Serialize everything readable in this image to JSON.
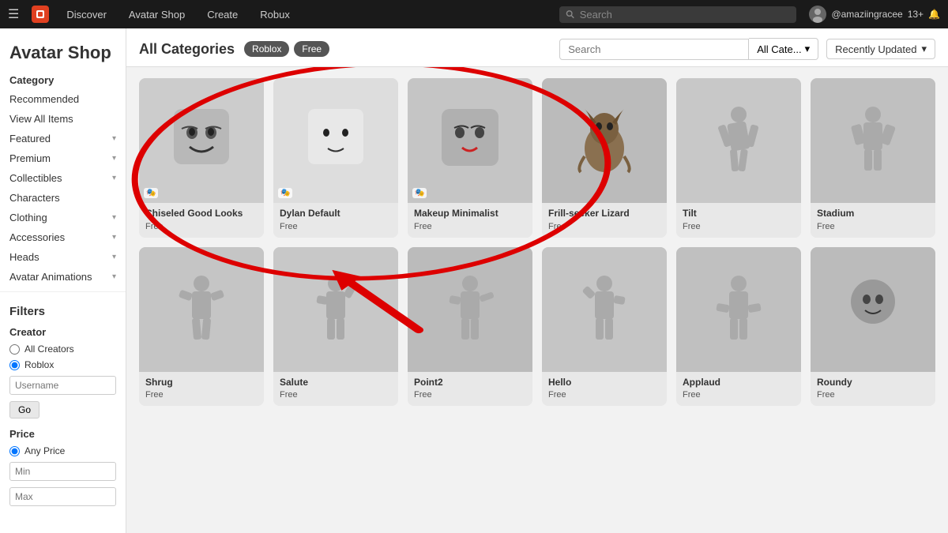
{
  "topbar": {
    "logo_text": "R",
    "links": [
      "Discover",
      "Avatar Shop",
      "Create",
      "Robux"
    ],
    "search_placeholder": "Search",
    "username": "@amaziingracee",
    "age": "13+"
  },
  "sidebar": {
    "page_title": "Avatar Shop",
    "section_label": "Category",
    "items": [
      {
        "label": "Recommended",
        "has_chevron": false
      },
      {
        "label": "View All Items",
        "has_chevron": false
      },
      {
        "label": "Featured",
        "has_chevron": true
      },
      {
        "label": "Premium",
        "has_chevron": true
      },
      {
        "label": "Collectibles",
        "has_chevron": true
      },
      {
        "label": "Characters",
        "has_chevron": false
      },
      {
        "label": "Clothing",
        "has_chevron": true
      },
      {
        "label": "Accessories",
        "has_chevron": true
      },
      {
        "label": "Heads",
        "has_chevron": true
      },
      {
        "label": "Avatar Animations",
        "has_chevron": true
      }
    ],
    "filters_title": "Filters",
    "creator_label": "Creator",
    "all_creators_label": "All Creators",
    "roblox_label": "Roblox",
    "username_placeholder": "Username",
    "go_button": "Go",
    "price_label": "Price",
    "any_price_label": "Any Price",
    "min_placeholder": "Min",
    "max_placeholder": "Max"
  },
  "content": {
    "title": "All Categories",
    "filters": [
      "Roblox",
      "Free"
    ],
    "sort_label": "Recently Updated",
    "search_placeholder": "Search",
    "allcate_label": "All Cate...",
    "items": [
      {
        "name": "Chiseled Good Looks",
        "price": "Free",
        "has_icon": true,
        "type": "face"
      },
      {
        "name": "Dylan Default",
        "price": "Free",
        "has_icon": true,
        "type": "face_simple"
      },
      {
        "name": "Makeup Minimalist",
        "price": "Free",
        "has_icon": true,
        "type": "face_makeup"
      },
      {
        "name": "Frill-seeker Lizard",
        "price": "Free",
        "has_icon": false,
        "type": "lizard"
      },
      {
        "name": "Tilt",
        "price": "Free",
        "has_icon": false,
        "type": "silhouette"
      },
      {
        "name": "Stadium",
        "price": "Free",
        "has_icon": false,
        "type": "silhouette"
      },
      {
        "name": "Shrug",
        "price": "Free",
        "has_icon": false,
        "type": "silhouette"
      },
      {
        "name": "Salute",
        "price": "Free",
        "has_icon": false,
        "type": "silhouette"
      },
      {
        "name": "Point2",
        "price": "Free",
        "has_icon": false,
        "type": "silhouette"
      },
      {
        "name": "Hello",
        "price": "Free",
        "has_icon": false,
        "type": "silhouette"
      },
      {
        "name": "Applaud",
        "price": "Free",
        "has_icon": false,
        "type": "silhouette"
      },
      {
        "name": "Roundy",
        "price": "Free",
        "has_icon": false,
        "type": "round_face"
      }
    ]
  }
}
